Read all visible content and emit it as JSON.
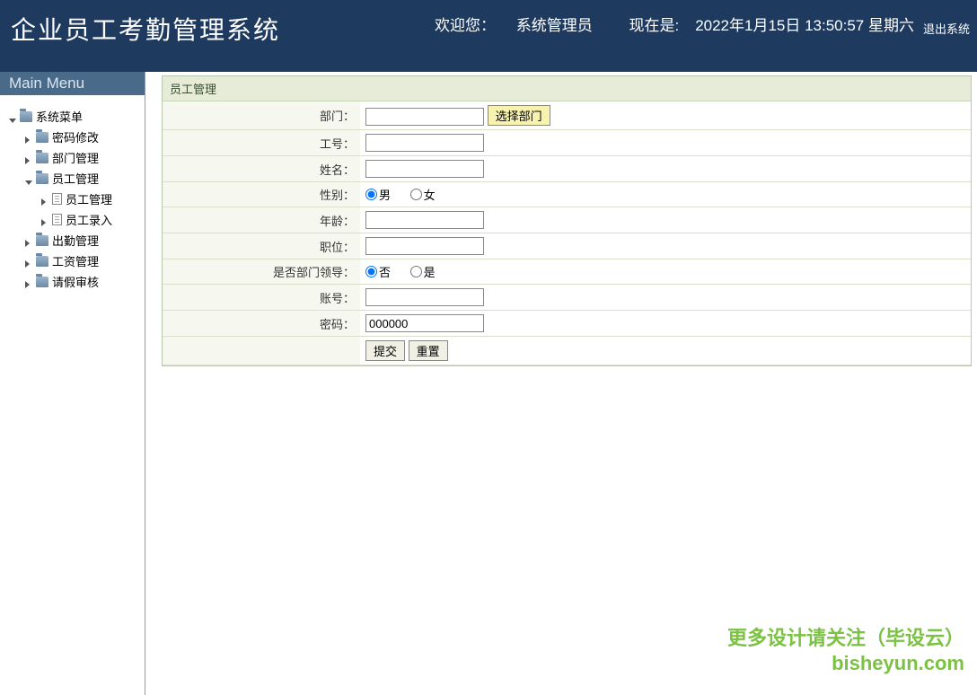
{
  "header": {
    "title": "企业员工考勤管理系统",
    "welcome_prefix": "欢迎您：",
    "user": "系统管理员",
    "now_prefix": "现在是:",
    "datetime": "2022年1月15日 13:50:57 星期六",
    "logout": "退出系统"
  },
  "sidebar": {
    "title": "Main Menu",
    "root": "系统菜单",
    "items": [
      {
        "label": "密码修改",
        "type": "folder"
      },
      {
        "label": "部门管理",
        "type": "folder"
      },
      {
        "label": "员工管理",
        "type": "folder",
        "expanded": true,
        "children": [
          {
            "label": "员工管理",
            "type": "file"
          },
          {
            "label": "员工录入",
            "type": "file"
          }
        ]
      },
      {
        "label": "出勤管理",
        "type": "folder"
      },
      {
        "label": "工资管理",
        "type": "folder"
      },
      {
        "label": "请假审核",
        "type": "folder"
      }
    ]
  },
  "panel": {
    "title": "员工管理"
  },
  "form": {
    "dept_label": "部门：",
    "dept_value": "",
    "dept_select_btn": "选择部门",
    "empno_label": "工号：",
    "empno_value": "",
    "name_label": "姓名：",
    "name_value": "",
    "gender_label": "性别：",
    "gender_male": "男",
    "gender_female": "女",
    "age_label": "年龄：",
    "age_value": "",
    "position_label": "职位：",
    "position_value": "",
    "leader_label": "是否部门领导：",
    "leader_no": "否",
    "leader_yes": "是",
    "account_label": "账号：",
    "account_value": "",
    "password_label": "密码：",
    "password_value": "000000",
    "submit": "提交",
    "reset": "重置"
  },
  "watermark": {
    "line1": "更多设计请关注（毕设云）",
    "line2": "bisheyun.com"
  }
}
